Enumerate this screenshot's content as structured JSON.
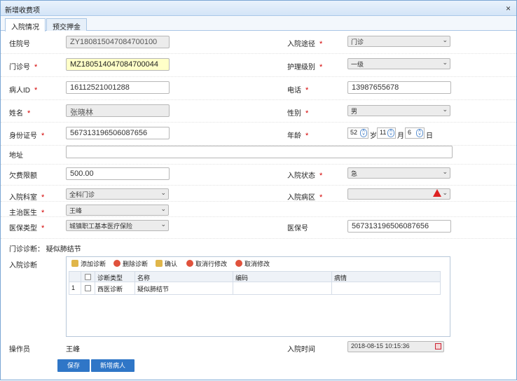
{
  "window": {
    "title": "新增收费项",
    "close": "×"
  },
  "tabs": [
    {
      "label": "入院情况"
    },
    {
      "label": "预交押金"
    }
  ],
  "form": {
    "admission_no": {
      "label": "住院号",
      "value": "ZY180815047084700100"
    },
    "admission_route": {
      "label": "入院途径",
      "value": "门诊"
    },
    "clinic_no": {
      "label": "门诊号",
      "value": "MZ180514047084700044"
    },
    "nursing_level": {
      "label": "护理级别",
      "value": "一级"
    },
    "patient_id": {
      "label": "病人ID",
      "value": "16112521001288"
    },
    "phone": {
      "label": "电话",
      "value": "13987655678"
    },
    "name": {
      "label": "姓名",
      "value": "张晓林"
    },
    "gender": {
      "label": "性别",
      "value": "男"
    },
    "id_card": {
      "label": "身份证号",
      "value": "567313196506087656"
    },
    "age": {
      "label": "年龄",
      "years": "52",
      "years_unit": "岁",
      "months": "11",
      "months_unit": "月",
      "days": "6",
      "days_unit": "日"
    },
    "address": {
      "label": "地址",
      "value": ""
    },
    "arrears_limit": {
      "label": "欠费限额",
      "value": "500.00"
    },
    "admission_status": {
      "label": "入院状态",
      "value": "急"
    },
    "department": {
      "label": "入院科室",
      "value": "全科门诊"
    },
    "ward": {
      "label": "入院病区",
      "value": ""
    },
    "doctor": {
      "label": "主治医生",
      "value": "王峰"
    },
    "insurance_type": {
      "label": "医保类型",
      "value": "城镇职工基本医疗保险"
    },
    "insurance_no": {
      "label": "医保号",
      "value": "567313196506087656"
    },
    "outpatient_diag": {
      "label": "门诊诊断：",
      "value": "疑似肺结节"
    },
    "admission_diag": {
      "label": "入院诊断"
    },
    "operator": {
      "label": "操作员",
      "value": "王峰"
    },
    "admission_time": {
      "label": "入院时间",
      "value": "2018-08-15 10:15:36"
    },
    "required_mark": "*"
  },
  "diag_toolbar": {
    "add": "添加诊断",
    "delete": "删除诊断",
    "confirm": "确认",
    "cancel_row": "取消行修改",
    "cancel": "取消修改"
  },
  "diag_table": {
    "columns": [
      "诊断类型",
      "名称",
      "编码",
      "病情"
    ],
    "rows": [
      {
        "no": "1",
        "type": "西医诊断",
        "name": "疑似肺结节",
        "code": "",
        "condition": ""
      }
    ]
  },
  "buttons": {
    "save": "保存",
    "new_patient": "新增病人"
  },
  "colors": {
    "primary_button": "#2f76c7",
    "required": "#d40000",
    "highlight_input": "#ffffc8"
  }
}
